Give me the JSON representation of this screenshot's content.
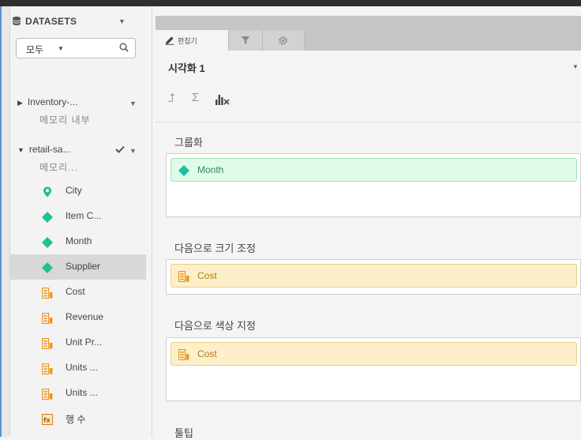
{
  "sidebar": {
    "header": "DATASETS",
    "filter": {
      "value": "모두"
    },
    "sources": [
      {
        "name": "Inventory-...",
        "subtitle": "메모리 내부"
      },
      {
        "name": "retail-sa...",
        "subtitle": "메모리..."
      }
    ],
    "fields": [
      {
        "label": "City",
        "kind": "geo"
      },
      {
        "label": "Item C...",
        "kind": "dimension"
      },
      {
        "label": "Month",
        "kind": "dimension"
      },
      {
        "label": "Supplier",
        "kind": "dimension",
        "selected": true
      },
      {
        "label": "Cost",
        "kind": "measure"
      },
      {
        "label": "Revenue",
        "kind": "measure"
      },
      {
        "label": "Unit Pr...",
        "kind": "measure"
      },
      {
        "label": "Units ...",
        "kind": "measure"
      },
      {
        "label": "Units ...",
        "kind": "measure"
      },
      {
        "label": "행 수",
        "kind": "calc"
      }
    ]
  },
  "panel": {
    "tabs": [
      {
        "label": "편집기",
        "icon": "pencil-icon",
        "active": true
      },
      {
        "label": "",
        "icon": "funnel-icon"
      },
      {
        "label": "",
        "icon": "gear-icon"
      }
    ],
    "title": "시각화 1",
    "sections": [
      {
        "title": "그룹화",
        "item": "Month",
        "kind": "dimension"
      },
      {
        "title": "다음으로 크기 조정",
        "item": "Cost",
        "kind": "measure"
      },
      {
        "title": "다음으로 색상 지정",
        "item": "Cost",
        "kind": "measure"
      },
      {
        "title": "툴팁"
      }
    ]
  },
  "colors": {
    "dimension": "#1fbf9a",
    "geo": "#1fbf9a",
    "measure": "#e9951f",
    "calc": "#c9861e"
  }
}
